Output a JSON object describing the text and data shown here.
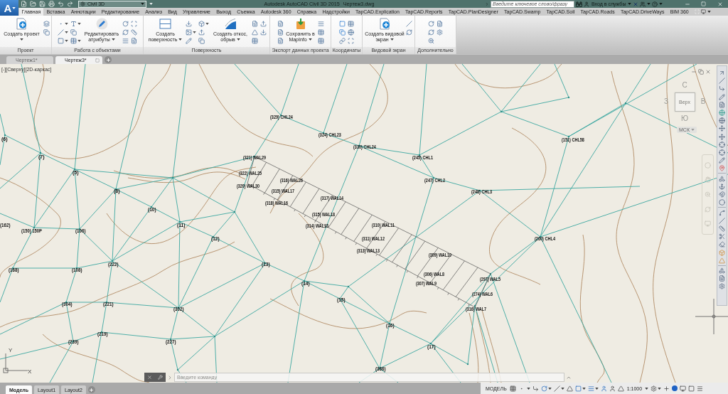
{
  "window": {
    "logo": "A",
    "workspace": "Civil 3D",
    "title": "Autodesk AutoCAD Civil 3D 2015",
    "document": "Чертеж3.dwg"
  },
  "search": {
    "placeholder": "Введите ключевое слово/фразу"
  },
  "account": {
    "label": "Вход в службы"
  },
  "menu_tabs": [
    {
      "label": "Главная",
      "selected": true
    },
    {
      "label": "Вставка",
      "selected": false
    },
    {
      "label": "Аннотации",
      "selected": false
    },
    {
      "label": "Редактирование",
      "selected": false
    },
    {
      "label": "Анализ",
      "selected": false
    },
    {
      "label": "Вид",
      "selected": false
    },
    {
      "label": "Управление",
      "selected": false
    },
    {
      "label": "Выход",
      "selected": false
    },
    {
      "label": "Съемка",
      "selected": false
    },
    {
      "label": "Autodesk 360",
      "selected": false
    },
    {
      "label": "Справка",
      "selected": false
    },
    {
      "label": "Надстройки",
      "selected": false
    },
    {
      "label": "TapCAD.Explication",
      "selected": false
    },
    {
      "label": "TapCAD.Reports",
      "selected": false
    },
    {
      "label": "TapCAD.PlanDesigner",
      "selected": false
    },
    {
      "label": "TapCAD.Swamp",
      "selected": false
    },
    {
      "label": "TapCAD.Soil",
      "selected": false
    },
    {
      "label": "TapCAD.Roads",
      "selected": false
    },
    {
      "label": "TapCAD.DriveWays",
      "selected": false
    },
    {
      "label": "BIM 360",
      "selected": false
    }
  ],
  "ribbon_panels": [
    {
      "title": "Проект",
      "items": [
        {
          "kind": "large",
          "label": "Создать проект",
          "dropdown": true
        },
        {
          "kind": "icons"
        }
      ]
    },
    {
      "title": "Работа с объектами",
      "items": [
        {
          "kind": "icons"
        },
        {
          "kind": "large",
          "label": "Редактировать атрибуты",
          "dropdown": true
        },
        {
          "kind": "icons"
        }
      ]
    },
    {
      "title": "Поверхность",
      "items": [
        {
          "kind": "large",
          "label": "Создать поверхность",
          "dropdown": true
        },
        {
          "kind": "icons"
        },
        {
          "kind": "large",
          "label": "Создать откос, обрыв",
          "dropdown": true
        },
        {
          "kind": "icons"
        }
      ]
    },
    {
      "title": "Экспорт данных проекта",
      "items": [
        {
          "kind": "icons"
        },
        {
          "kind": "large",
          "label": "Сохранить в MapInfo",
          "dropdown": true
        },
        {
          "kind": "icons"
        }
      ]
    },
    {
      "title": "Координаты",
      "items": [
        {
          "kind": "icons"
        }
      ]
    },
    {
      "title": "Видовой экран",
      "items": [
        {
          "kind": "large",
          "label": "Создать видовой экран",
          "dropdown": true
        },
        {
          "kind": "icons"
        }
      ]
    },
    {
      "title": "Дополнительно",
      "items": [
        {
          "kind": "icons"
        }
      ]
    }
  ],
  "document_tabs": [
    {
      "label": "Чертеж1*",
      "selected": false
    },
    {
      "label": "Чертеж3*",
      "selected": true
    }
  ],
  "viewport": {
    "label": "[-][Сверху][2D-каркас]",
    "viewcube": {
      "north": "С",
      "west": "З",
      "face": "Верх",
      "east": "В",
      "south": "Ю",
      "ucs": "МСК"
    },
    "ucs_icon": {
      "y_axis": "Y",
      "x_axis": "X"
    }
  },
  "point_labels": [
    "(329) CHL24",
    "(324) CHL23",
    "(6)",
    "(151) CHL58",
    "(330) CHL24",
    "(7)",
    "(321) WAL29",
    "(245) CHL1",
    "(5)",
    "(322) WAL25",
    "(316) WAL26",
    "(247) CHL2",
    "(320) WAL30",
    "(8)",
    "(315) WAL17",
    "(248) CHL3",
    "(317) WAL14",
    "(318) WAL16",
    "(10)",
    "(315) WAL18",
    "(162)",
    "(11)",
    "(314) WAL15",
    "(310) WAL11",
    "(150) 150P",
    "(106)",
    "(12)",
    "(311) WAL12",
    "(260) CHL4",
    "(313) WAL13",
    "(309) WAL10",
    "(222)",
    "(13)",
    "(168)",
    "(108)",
    "(306) WAL8",
    "(297) WAL5",
    "(14)",
    "(307) WAL9",
    "(274) WAL6",
    "(15)",
    "(304)",
    "(221)",
    "(302)",
    "(316) WAL7",
    "(16)",
    "(219)",
    "(239)",
    "(227)",
    "(17)",
    "(386)"
  ],
  "command_line": {
    "placeholder": "Введите команду"
  },
  "layout_tabs": [
    {
      "label": "Модель",
      "selected": true
    },
    {
      "label": "Layout1",
      "selected": false
    },
    {
      "label": "Layout2",
      "selected": false
    }
  ],
  "status_bar": {
    "space": "МОДЕЛЬ",
    "scale": "1:1000"
  }
}
